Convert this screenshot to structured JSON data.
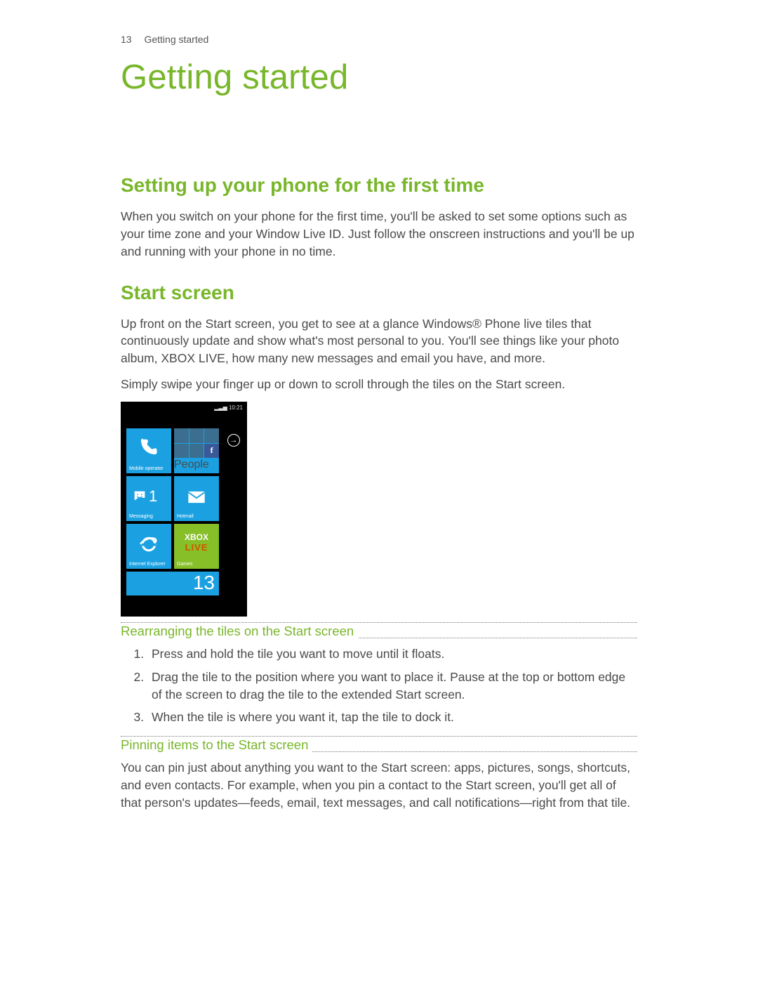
{
  "header": {
    "page_number": "13",
    "running_title": "Getting started"
  },
  "chapter_title": "Getting started",
  "sections": {
    "setup": {
      "heading": "Setting up your phone for the first time",
      "body": "When you switch on your phone for the first time, you'll be asked to set some options such as your time zone and your Window Live ID. Just follow the onscreen instructions and you'll be up and running with your phone in no time."
    },
    "start_screen": {
      "heading": "Start screen",
      "body1": "Up front on the Start screen, you get to see at a glance Windows® Phone live tiles that continuously update and show what's most personal to you. You'll see things like your photo album, XBOX LIVE, how many new messages and email you have, and more.",
      "body2": "Simply swipe your finger up or down to scroll through the tiles on the Start screen."
    },
    "rearranging": {
      "heading": "Rearranging the tiles on the Start screen",
      "steps": [
        "Press and hold the tile you want to move until it floats.",
        "Drag the tile to the position where you want to place it. Pause at the top or bottom edge of the screen to drag the tile to the extended Start screen.",
        "When the tile is where you want it, tap the tile to dock it."
      ]
    },
    "pinning": {
      "heading": "Pinning items to the Start screen",
      "body": "You can pin just about anything you want to the Start screen: apps, pictures, songs, shortcuts, and even contacts. For example, when you pin a contact to the Start screen, you'll get all of that person's updates—feeds, email, text messages, and call notifications—right from that tile."
    }
  },
  "phone_screenshot": {
    "status_time": "10:21",
    "arrow_glyph": "→",
    "tiles": {
      "phone_label": "Mobile operator",
      "people_label": "People",
      "messaging_label": "Messaging",
      "messaging_count": "1",
      "hotmail_label": "Hotmail",
      "ie_label": "Internet Explorer",
      "xbox_top": "XBOX",
      "xbox_bottom": "LIVE",
      "games_label": "Games",
      "calendar_number": "13"
    }
  }
}
